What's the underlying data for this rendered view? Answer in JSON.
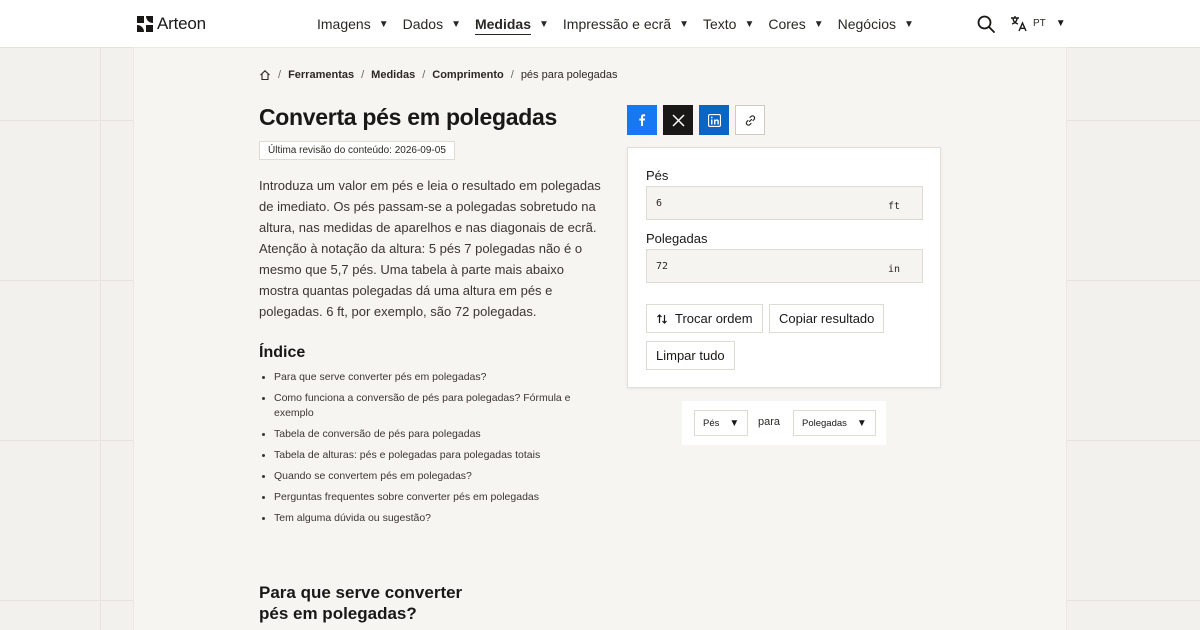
{
  "header": {
    "brand": "Arteon",
    "nav": [
      {
        "label": "Imagens",
        "active": false
      },
      {
        "label": "Dados",
        "active": false
      },
      {
        "label": "Medidas",
        "active": true
      },
      {
        "label": "Impressão e ecrã",
        "active": false
      },
      {
        "label": "Texto",
        "active": false
      },
      {
        "label": "Cores",
        "active": false
      },
      {
        "label": "Negócios",
        "active": false
      }
    ],
    "language": "PT",
    "icons": {
      "search": "search-icon",
      "language": "translate-icon"
    }
  },
  "breadcrumb": {
    "items": [
      "Ferramentas",
      "Medidas",
      "Comprimento"
    ],
    "current": "pés para polegadas"
  },
  "page": {
    "title": "Converta pés em polegadas",
    "revision": "Última revisão do conteúdo: 2026-09-05",
    "intro": "Introduza um valor em pés e leia o resultado em polegadas de imediato. Os pés passam-se a polegadas sobretudo na altura, nas medidas de aparelhos e nas diagonais de ecrã. Atenção à notação da altura: 5 pés 7 polegadas não é o mesmo que 5,7 pés. Uma tabela à parte mais abaixo mostra quantas polegadas dá uma altura em pés e polegadas. 6 ft, por exemplo, são 72 polegadas.",
    "toc_title": "Índice",
    "toc": [
      "Para que serve converter pés em polegadas?",
      "Como funciona a conversão de pés para polegadas? Fórmula e exemplo",
      "Tabela de conversão de pés para polegadas",
      "Tabela de alturas: pés e polegadas para polegadas totais",
      "Quando se convertem pés em polegadas?",
      "Perguntas frequentes sobre converter pés em polegadas",
      "Tem alguma dúvida ou sugestão?"
    ],
    "section_title": "Para que serve converter pés em polegadas?"
  },
  "share": {
    "icons": [
      "facebook-icon",
      "x-icon",
      "linkedin-icon",
      "link-icon"
    ],
    "colors": {
      "facebook": "#1877f2",
      "x": "#1a1816",
      "linkedin": "#0a66c2"
    }
  },
  "converter": {
    "from_label": "Pés",
    "from_value": "6",
    "from_unit": "ft",
    "to_label": "Polegadas",
    "to_value": "72",
    "to_unit": "in",
    "swap_label": "Trocar ordem",
    "copy_label": "Copiar resultado",
    "clear_label": "Limpar tudo"
  },
  "unit_selector": {
    "from": "Pés",
    "connector": "para",
    "to": "Polegadas"
  }
}
